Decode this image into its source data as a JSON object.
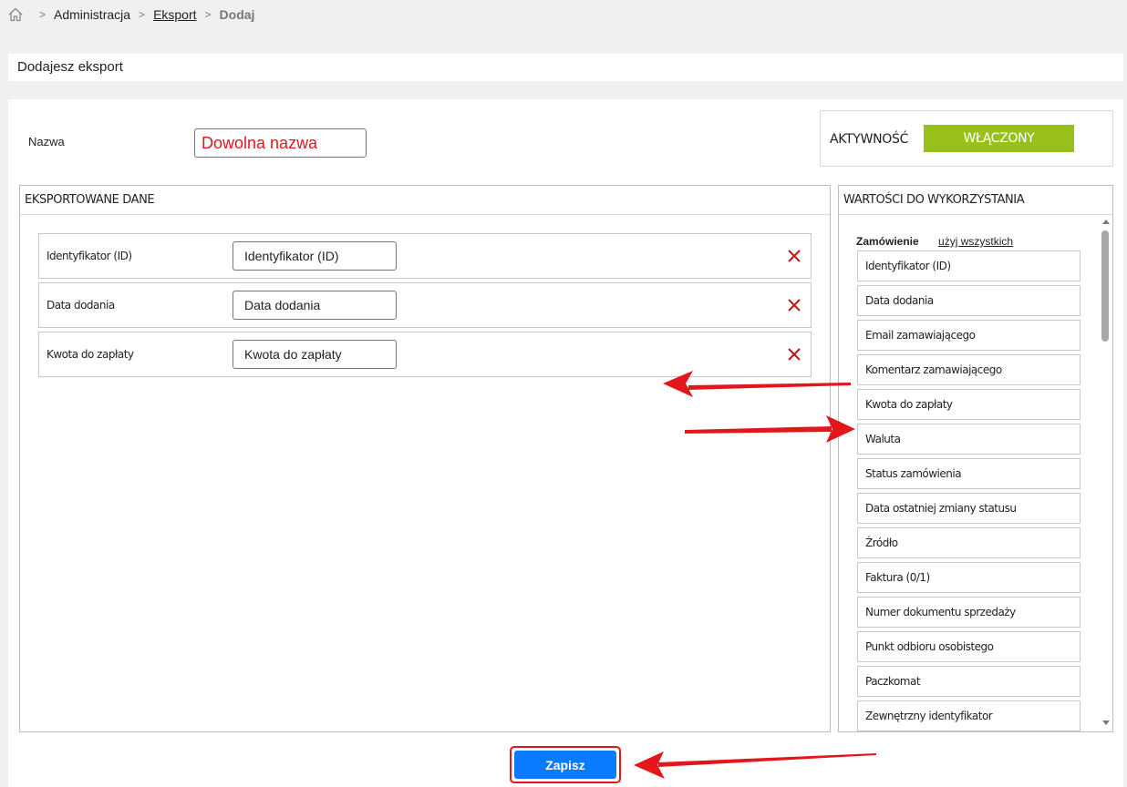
{
  "breadcrumb": {
    "items": [
      "Administracja",
      "Eksport",
      "Dodaj"
    ]
  },
  "page_title": "Dodajesz eksport",
  "form": {
    "name_label": "Nazwa",
    "name_value": "Dowolna nazwa"
  },
  "activity": {
    "label": "AKTYWNOŚĆ",
    "state": "WŁĄCZONY",
    "color": "#97c11a"
  },
  "exported": {
    "header": "EKSPORTOWANE DANE",
    "rows": [
      {
        "label": "Identyfikator (ID)",
        "value": "Identyfikator (ID)"
      },
      {
        "label": "Data dodania",
        "value": "Data dodania"
      },
      {
        "label": "Kwota do zapłaty",
        "value": "Kwota do zapłaty"
      }
    ]
  },
  "values": {
    "header": "WARTOŚCI DO WYKORZYSTANIA",
    "group_name": "Zamówienie",
    "use_all": "użyj wszystkich",
    "items": [
      "Identyfikator (ID)",
      "Data dodania",
      "Email zamawiającego",
      "Komentarz zamawiającego",
      "Kwota do zapłaty",
      "Waluta",
      "Status zamówienia",
      "Data ostatniej zmiany statusu",
      "Źródło",
      "Faktura (0/1)",
      "Numer dokumentu sprzedaży",
      "Punkt odbioru osobistego",
      "Paczkomat",
      "Zewnętrzny identyfikator"
    ]
  },
  "save_label": "Zapisz",
  "colors": {
    "save": "#0a7bff",
    "highlight": "#e3161b",
    "remove": "#c0151a"
  }
}
